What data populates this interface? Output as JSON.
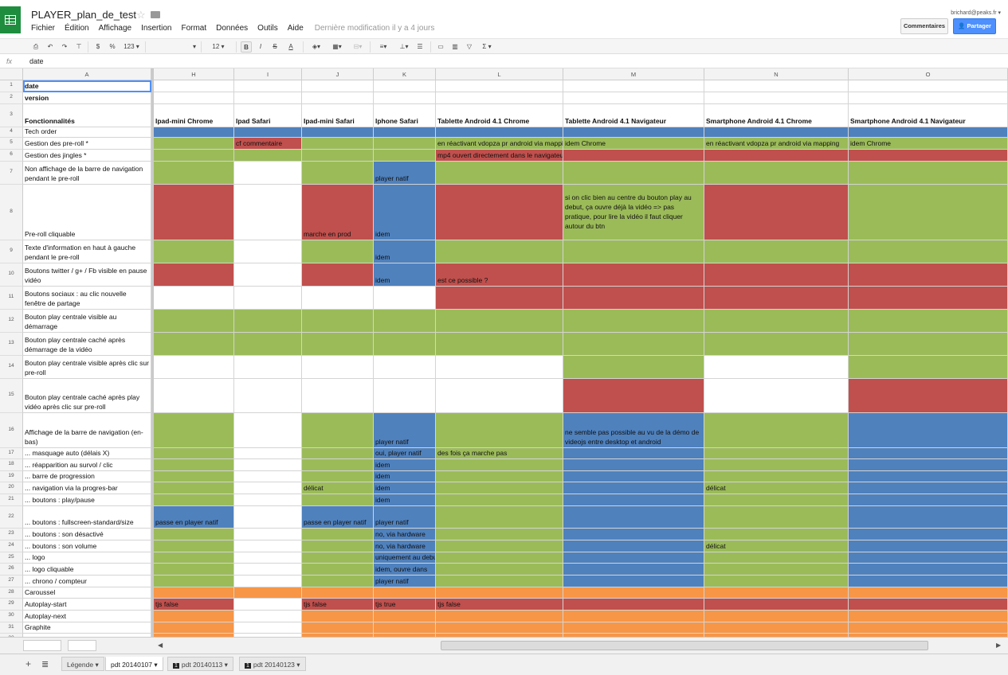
{
  "app": {
    "doc_title": "PLAYER_plan_de_test",
    "user": "brichard@peaks.fr ▾",
    "comments_label": "Commentaires",
    "share_label": "Partager",
    "menu": [
      "Fichier",
      "Édition",
      "Affichage",
      "Insertion",
      "Format",
      "Données",
      "Outils",
      "Aide"
    ],
    "last_modified": "Dernière modification il y a 4 jours"
  },
  "toolbar": {
    "currency": "$",
    "percent": "%",
    "format123": "123 ▾",
    "font_size": "12 ▾",
    "bold": "B",
    "italic": "I",
    "strike": "S",
    "text_color": "A",
    "sigma": "Σ ▾"
  },
  "formula_bar": {
    "fx": "fx",
    "value": "date"
  },
  "columns": [
    "A",
    "H",
    "I",
    "J",
    "K",
    "L",
    "M",
    "N",
    "O"
  ],
  "colors": {
    "green": "#9bbb59",
    "red": "#c0504d",
    "blue": "#4f81bd",
    "orange": "#f79646",
    "white": "#ffffff"
  },
  "rows": [
    {
      "n": "1",
      "a": "date",
      "bold": true,
      "fill": [
        "w",
        "w",
        "w",
        "w",
        "w",
        "w",
        "w",
        "w"
      ],
      "texts": [
        "",
        "",
        "",
        "",
        "",
        "",
        "",
        ""
      ]
    },
    {
      "n": "2",
      "a": "version",
      "bold": true,
      "fill": [
        "w",
        "w",
        "w",
        "w",
        "w",
        "w",
        "w",
        "w"
      ],
      "texts": [
        "",
        "",
        "",
        "",
        "",
        "",
        "",
        ""
      ]
    },
    {
      "n": "3",
      "a": "Fonctionnalités",
      "bold": true,
      "fill": [
        "w",
        "w",
        "w",
        "w",
        "w",
        "w",
        "w",
        "w"
      ],
      "texts": [
        "Ipad-mini Chrome",
        "Ipad Safari",
        "Ipad-mini Safari",
        "Iphone Safari",
        "Tablette Android 4.1 Chrome",
        "Tablette Android 4.1 Navigateur",
        "Smartphone Android 4.1 Chrome",
        "Smartphone Android 4.1 Navigateur"
      ]
    },
    {
      "n": "4",
      "a": "Tech order",
      "fill": [
        "b",
        "b",
        "b",
        "b",
        "b",
        "b",
        "b",
        "b"
      ],
      "texts": [
        "",
        "",
        "",
        "",
        "",
        "",
        "",
        ""
      ]
    },
    {
      "n": "5",
      "a": "Gestion des pre-roll *",
      "fill": [
        "g",
        "r",
        "g",
        "g",
        "g",
        "g",
        "g",
        "g"
      ],
      "texts": [
        "",
        "cf commentaire",
        "",
        "",
        "en réactivant vdopza pr android via mapping",
        "idem Chrome",
        "en réactivant vdopza pr android via mapping",
        "idem Chrome"
      ]
    },
    {
      "n": "6",
      "a": "Gestion des jingles *",
      "fill": [
        "g",
        "g",
        "g",
        "g",
        "r",
        "r",
        "r",
        "r"
      ],
      "texts": [
        "",
        "",
        "",
        "",
        "mp4 ouvert directement dans le navigateur",
        "",
        "",
        ""
      ]
    },
    {
      "n": "7",
      "a": "Non affichage de la barre de navigation pendant le pre-roll",
      "fill": [
        "g",
        "w",
        "g",
        "b",
        "g",
        "g",
        "g",
        "g"
      ],
      "texts": [
        "",
        "",
        "",
        "player natif",
        "",
        "",
        "",
        ""
      ]
    },
    {
      "n": "8",
      "a": "Pre-roll cliquable",
      "fill": [
        "r",
        "w",
        "r",
        "b",
        "r",
        "g",
        "r",
        "g"
      ],
      "texts": [
        "",
        "",
        "marche en prod",
        "idem",
        "",
        "si on clic bien au centre du bouton play au debut, ça ouvre déjà la vidéo => pas pratique, pour lire la vidéo il faut cliquer autour du btn",
        "",
        ""
      ]
    },
    {
      "n": "9",
      "a": "Texte d'information en haut à gauche pendant le pre-roll",
      "fill": [
        "g",
        "w",
        "g",
        "b",
        "g",
        "g",
        "g",
        "g"
      ],
      "texts": [
        "",
        "",
        "",
        "idem",
        "",
        "",
        "",
        ""
      ]
    },
    {
      "n": "10",
      "a": "Boutons twitter / g+ / Fb visible en pause vidéo",
      "fill": [
        "r",
        "w",
        "r",
        "b",
        "r",
        "r",
        "r",
        "r"
      ],
      "texts": [
        "",
        "",
        "",
        "idem",
        "est ce possible ?",
        "",
        "",
        ""
      ]
    },
    {
      "n": "11",
      "a": "Boutons sociaux : au clic nouvelle fenêtre de partage",
      "fill": [
        "w",
        "w",
        "w",
        "w",
        "r",
        "r",
        "r",
        "r"
      ],
      "texts": [
        "",
        "",
        "",
        "",
        "",
        "",
        "",
        ""
      ]
    },
    {
      "n": "12",
      "a": "Bouton play centrale visible au démarrage",
      "fill": [
        "g",
        "g",
        "g",
        "g",
        "g",
        "g",
        "g",
        "g"
      ],
      "texts": [
        "",
        "",
        "",
        "",
        "",
        "",
        "",
        ""
      ]
    },
    {
      "n": "13",
      "a": "Bouton play centrale caché après démarrage de la vidéo",
      "fill": [
        "g",
        "g",
        "g",
        "g",
        "g",
        "g",
        "g",
        "g"
      ],
      "texts": [
        "",
        "",
        "",
        "",
        "",
        "",
        "",
        ""
      ]
    },
    {
      "n": "14",
      "a": "Bouton play centrale visible après clic sur pre-roll",
      "fill": [
        "w",
        "w",
        "w",
        "w",
        "w",
        "g",
        "w",
        "g"
      ],
      "texts": [
        "",
        "",
        "",
        "",
        "",
        "",
        "",
        ""
      ]
    },
    {
      "n": "15",
      "a": "Bouton play centrale caché après play vidéo après clic sur pre-roll",
      "fill": [
        "w",
        "w",
        "w",
        "w",
        "w",
        "r",
        "w",
        "r"
      ],
      "texts": [
        "",
        "",
        "",
        "",
        "",
        "",
        "",
        ""
      ]
    },
    {
      "n": "16",
      "a": "Affichage de la barre de navigation (en-bas)",
      "fill": [
        "g",
        "w",
        "g",
        "b",
        "g",
        "b",
        "g",
        "b"
      ],
      "texts": [
        "",
        "",
        "",
        "player natif",
        "",
        "ne semble pas possible au vu de la démo de videojs entre desktop et android",
        "",
        ""
      ]
    },
    {
      "n": "17",
      "a": "... masquage auto (délais X)",
      "fill": [
        "g",
        "w",
        "g",
        "b",
        "g",
        "b",
        "g",
        "b"
      ],
      "texts": [
        "",
        "",
        "",
        "oui, player natif",
        "des fois ça marche pas",
        "",
        "",
        ""
      ]
    },
    {
      "n": "18",
      "a": "... réapparition au survol / clic",
      "fill": [
        "g",
        "w",
        "g",
        "b",
        "g",
        "b",
        "g",
        "b"
      ],
      "texts": [
        "",
        "",
        "",
        "idem",
        "",
        "",
        "",
        ""
      ]
    },
    {
      "n": "19",
      "a": "... barre de progression",
      "fill": [
        "g",
        "w",
        "g",
        "b",
        "g",
        "b",
        "g",
        "b"
      ],
      "texts": [
        "",
        "",
        "",
        "idem",
        "",
        "",
        "",
        ""
      ]
    },
    {
      "n": "20",
      "a": "... navigation via la progres-bar",
      "fill": [
        "g",
        "w",
        "g",
        "b",
        "g",
        "b",
        "g",
        "b"
      ],
      "texts": [
        "",
        "",
        "délicat",
        "idem",
        "",
        "",
        "délicat",
        ""
      ]
    },
    {
      "n": "21",
      "a": "... boutons : play/pause",
      "fill": [
        "g",
        "w",
        "g",
        "b",
        "g",
        "b",
        "g",
        "b"
      ],
      "texts": [
        "",
        "",
        "",
        "idem",
        "",
        "",
        "",
        ""
      ]
    },
    {
      "n": "22",
      "a": "... boutons : fullscreen-standard/size",
      "fill": [
        "b",
        "w",
        "b",
        "b",
        "g",
        "b",
        "g",
        "b"
      ],
      "texts": [
        "passe en player natif",
        "",
        "passe en player natif",
        "player natif",
        "",
        "",
        "",
        ""
      ]
    },
    {
      "n": "23",
      "a": "... boutons : son désactivé",
      "fill": [
        "g",
        "w",
        "g",
        "b",
        "g",
        "b",
        "g",
        "b"
      ],
      "texts": [
        "",
        "",
        "",
        "no, via hardware",
        "",
        "",
        "",
        ""
      ]
    },
    {
      "n": "24",
      "a": "... boutons : son volume",
      "fill": [
        "g",
        "w",
        "g",
        "b",
        "g",
        "b",
        "g",
        "b"
      ],
      "texts": [
        "",
        "",
        "",
        "no, via hardware",
        "",
        "",
        "délicat",
        ""
      ]
    },
    {
      "n": "25",
      "a": "... logo",
      "fill": [
        "g",
        "w",
        "g",
        "b",
        "g",
        "b",
        "g",
        "b"
      ],
      "texts": [
        "",
        "",
        "",
        "uniquement au debut",
        "",
        "",
        "",
        ""
      ]
    },
    {
      "n": "26",
      "a": "... logo cliquable",
      "fill": [
        "g",
        "w",
        "g",
        "b",
        "g",
        "b",
        "g",
        "b"
      ],
      "texts": [
        "",
        "",
        "",
        "idem, ouvre dans",
        "",
        "",
        "",
        ""
      ]
    },
    {
      "n": "27",
      "a": "... chrono / compteur",
      "fill": [
        "g",
        "w",
        "g",
        "b",
        "g",
        "b",
        "g",
        "b"
      ],
      "texts": [
        "",
        "",
        "",
        "player natif",
        "",
        "",
        "",
        ""
      ]
    },
    {
      "n": "28",
      "a": "Caroussel",
      "fill": [
        "o",
        "o",
        "o",
        "o",
        "o",
        "o",
        "o",
        "o"
      ],
      "texts": [
        "",
        "",
        "",
        "",
        "",
        "",
        "",
        ""
      ]
    },
    {
      "n": "29",
      "a": "Autoplay-start",
      "fill": [
        "r",
        "w",
        "r",
        "r",
        "r",
        "r",
        "r",
        "r"
      ],
      "texts": [
        "tjs false",
        "",
        "tjs false",
        "tjs true",
        "tjs false",
        "",
        "",
        ""
      ]
    },
    {
      "n": "30",
      "a": "Autoplay-next",
      "fill": [
        "o",
        "w",
        "o",
        "o",
        "o",
        "o",
        "o",
        "o"
      ],
      "texts": [
        "",
        "",
        "",
        "",
        "",
        "",
        "",
        ""
      ]
    },
    {
      "n": "31",
      "a": "Graphite",
      "fill": [
        "o",
        "w",
        "o",
        "o",
        "o",
        "o",
        "o",
        "o"
      ],
      "texts": [
        "",
        "",
        "",
        "",
        "",
        "",
        "",
        ""
      ]
    },
    {
      "n": "32",
      "a": "Estat",
      "fill": [
        "o",
        "w",
        "o",
        "o",
        "o",
        "o",
        "o",
        "o"
      ],
      "texts": [
        "",
        "",
        "",
        "",
        "",
        "",
        "",
        ""
      ]
    }
  ],
  "sheet_tabs": [
    {
      "label": "Légende ▾",
      "active": false
    },
    {
      "label": "pdt 20140107 ▾",
      "active": true
    },
    {
      "label": "pdt 20140113 ▾",
      "active": false,
      "badge": "1"
    },
    {
      "label": "pdt 20140123 ▾",
      "active": false,
      "badge": "1"
    }
  ]
}
